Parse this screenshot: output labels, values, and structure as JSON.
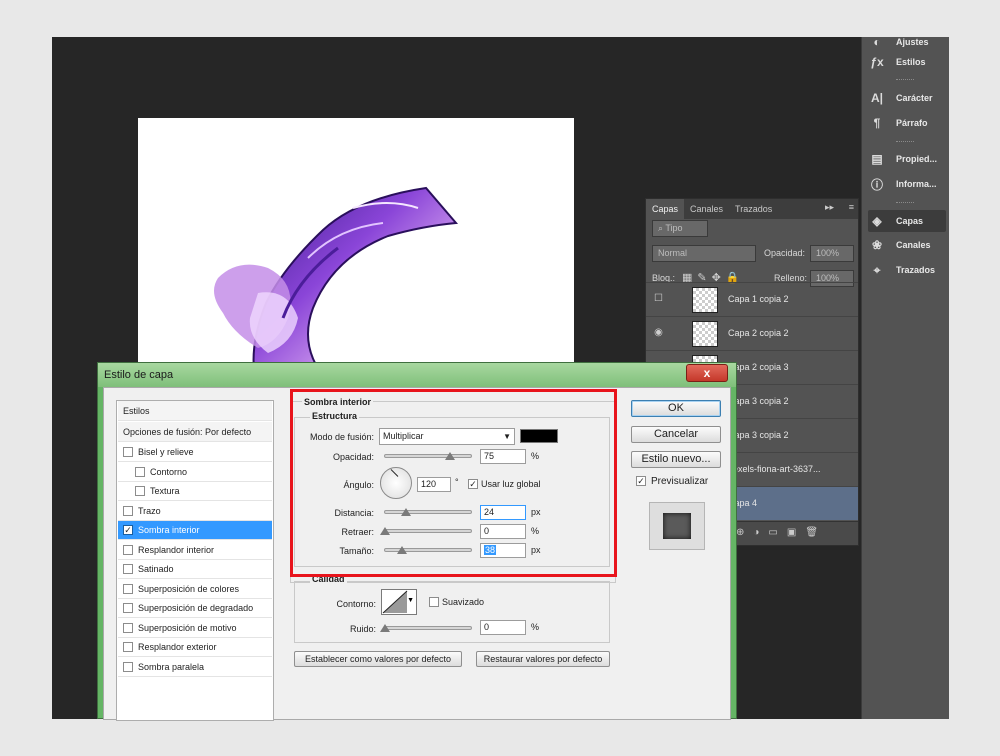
{
  "right_dock": {
    "items": [
      {
        "label": "Ajustes",
        "icon": "adjustments-icon"
      },
      {
        "label": "Estilos",
        "icon": "styles-icon"
      },
      {
        "label": "Carácter",
        "icon": "character-icon"
      },
      {
        "label": "Párrafo",
        "icon": "paragraph-icon"
      },
      {
        "label": "Propied...",
        "icon": "properties-icon"
      },
      {
        "label": "Informa...",
        "icon": "info-icon"
      },
      {
        "label": "Capas",
        "icon": "layers-icon"
      },
      {
        "label": "Canales",
        "icon": "channels-icon"
      },
      {
        "label": "Trazados",
        "icon": "paths-icon"
      }
    ]
  },
  "layers_panel": {
    "tabs": [
      "Capas",
      "Canales",
      "Trazados"
    ],
    "filter_label": "Tipo",
    "blend_mode": "Normal",
    "opacity_label": "Opacidad:",
    "opacity_value": "100%",
    "lock_label": "Bloq.:",
    "fill_label": "Relleno:",
    "fill_value": "100%",
    "layers": [
      {
        "name": "Capa 1 copia 2",
        "visible": false
      },
      {
        "name": "Capa 2 copia 2",
        "visible": true
      },
      {
        "name": "Capa 2 copia 3",
        "visible": true
      },
      {
        "name": "Capa 3 copia 2",
        "visible": true
      },
      {
        "name": "Capa 3 copia 2",
        "visible": true
      },
      {
        "name": "pexels-fiona-art-3637...",
        "visible": true
      },
      {
        "name": "Capa 4",
        "visible": true
      }
    ]
  },
  "dialog": {
    "title": "Estilo de capa",
    "close_label": "x",
    "style_list": {
      "header": "Estilos",
      "blend_options": "Opciones de fusión: Por defecto",
      "items": [
        {
          "label": "Bisel y relieve",
          "checked": false,
          "indent": false
        },
        {
          "label": "Contorno",
          "checked": false,
          "indent": true
        },
        {
          "label": "Textura",
          "checked": false,
          "indent": true
        },
        {
          "label": "Trazo",
          "checked": false,
          "indent": false
        },
        {
          "label": "Sombra interior",
          "checked": true,
          "indent": false,
          "selected": true
        },
        {
          "label": "Resplandor interior",
          "checked": false,
          "indent": false
        },
        {
          "label": "Satinado",
          "checked": false,
          "indent": false
        },
        {
          "label": "Superposición de colores",
          "checked": false,
          "indent": false
        },
        {
          "label": "Superposición de degradado",
          "checked": false,
          "indent": false
        },
        {
          "label": "Superposición de motivo",
          "checked": false,
          "indent": false
        },
        {
          "label": "Resplandor exterior",
          "checked": false,
          "indent": false
        },
        {
          "label": "Sombra paralela",
          "checked": false,
          "indent": false
        }
      ]
    },
    "section_title": "Sombra interior",
    "structure_title": "Estructura",
    "blend_mode_label": "Modo de fusión:",
    "blend_mode_value": "Multiplicar",
    "shadow_color": "#000000",
    "opacity_label": "Opacidad:",
    "opacity_value": "75",
    "opacity_level": 0.75,
    "angle_label": "Ángulo:",
    "angle_value": "120",
    "degree_symbol": "°",
    "global_light_label": "Usar luz global",
    "global_light_checked": true,
    "distance_label": "Distancia:",
    "distance_value": "24",
    "choke_label": "Retraer:",
    "choke_value": "0",
    "size_label": "Tamaño:",
    "size_value": "38",
    "unit_px": "px",
    "unit_percent": "%",
    "quality_title": "Calidad",
    "contour_label": "Contorno:",
    "antialias_label": "Suavizado",
    "noise_label": "Ruido:",
    "noise_value": "0",
    "make_default": "Establecer como valores por defecto",
    "reset_default": "Restaurar valores por defecto",
    "ok_label": "OK",
    "cancel_label": "Cancelar",
    "new_style_label": "Estilo nuevo...",
    "preview_label": "Previsualizar",
    "preview_checked": true
  },
  "colors": {
    "highlight": "#e8141c",
    "selection": "#3399ff"
  }
}
